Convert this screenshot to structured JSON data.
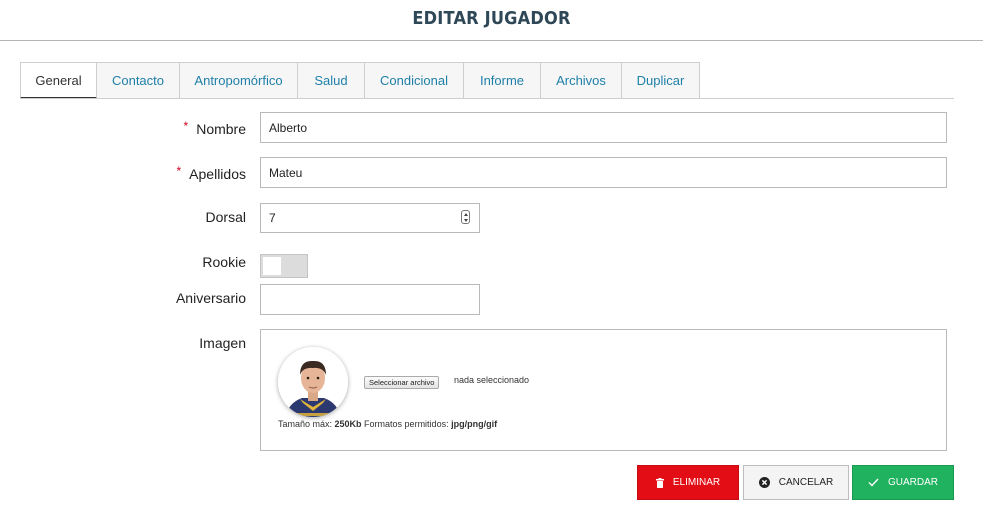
{
  "page": {
    "title": "EDITAR JUGADOR"
  },
  "tabs": [
    {
      "label": "General",
      "active": true
    },
    {
      "label": "Contacto"
    },
    {
      "label": "Antropomórfico"
    },
    {
      "label": "Salud"
    },
    {
      "label": "Condicional"
    },
    {
      "label": "Informe"
    },
    {
      "label": "Archivos"
    },
    {
      "label": "Duplicar"
    }
  ],
  "form": {
    "required_mark": "*",
    "nombre": {
      "label": "Nombre",
      "value": "Alberto",
      "required": true
    },
    "apellidos": {
      "label": "Apellidos",
      "value": "Mateu",
      "required": true
    },
    "dorsal": {
      "label": "Dorsal",
      "value": "7"
    },
    "rookie": {
      "label": "Rookie",
      "checked": false
    },
    "aniversario": {
      "label": "Aniversario",
      "value": ""
    },
    "imagen": {
      "label": "Imagen",
      "file_button": "Seleccionar archivo",
      "file_status": "nada seleccionado",
      "hint_prefix": "Tamaño máx: ",
      "max_size": "250Kb",
      "hint_mid": " Formatos permitidos: ",
      "formats": "jpg/png/gif"
    }
  },
  "actions": {
    "delete": "ELIMINAR",
    "cancel": "CANCELAR",
    "save": "GUARDAR"
  },
  "colors": {
    "delete": "#e30e15",
    "save": "#21b25f",
    "tab_link": "#1e7fa8",
    "required": "#d0021b"
  }
}
